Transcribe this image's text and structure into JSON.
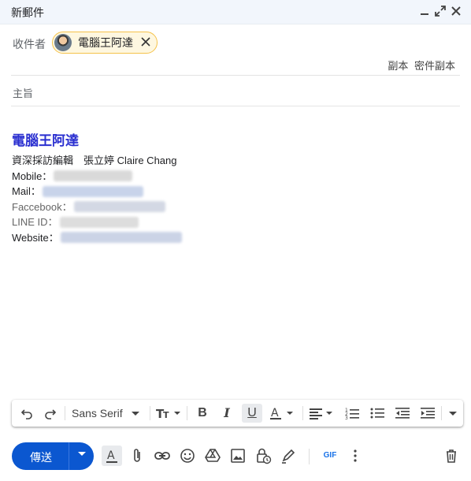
{
  "window": {
    "title": "新郵件",
    "minimize_icon": "minimize-icon",
    "expand_icon": "expand-icon",
    "close_icon": "close-icon"
  },
  "recipients": {
    "label": "收件者",
    "chips": [
      {
        "name": "電腦王阿達",
        "avatar": "avatar-photo",
        "remove_icon": "close-icon"
      }
    ],
    "cc_label": "副本",
    "bcc_label": "密件副本"
  },
  "subject": {
    "placeholder": "主旨"
  },
  "signature": {
    "name": "電腦王阿達",
    "title_line": "資深採訪編輯　張立婷 Claire Chang",
    "fields": [
      {
        "label": "Mobile："
      },
      {
        "label": "Mail："
      },
      {
        "label": "Faccebook："
      },
      {
        "label": "LINE ID："
      },
      {
        "label": "Website："
      }
    ]
  },
  "format_toolbar": {
    "font": "Sans Serif",
    "items": [
      "undo-icon",
      "redo-icon",
      "font-size-icon",
      "bold-icon",
      "italic-icon",
      "underline-icon",
      "text-color-icon",
      "align-icon",
      "numbered-list-icon",
      "bulleted-list-icon",
      "indent-less-icon",
      "indent-more-icon",
      "more-formatting-icon"
    ]
  },
  "bottom_bar": {
    "send_label": "傳送",
    "gif_label": "GIF"
  },
  "colors": {
    "send_button": "#0b57d0",
    "signature_name": "#2a2fd0",
    "chip_border": "#f5c24a",
    "chip_bg": "#fef7e0",
    "title_bar": "#f2f6fc"
  }
}
